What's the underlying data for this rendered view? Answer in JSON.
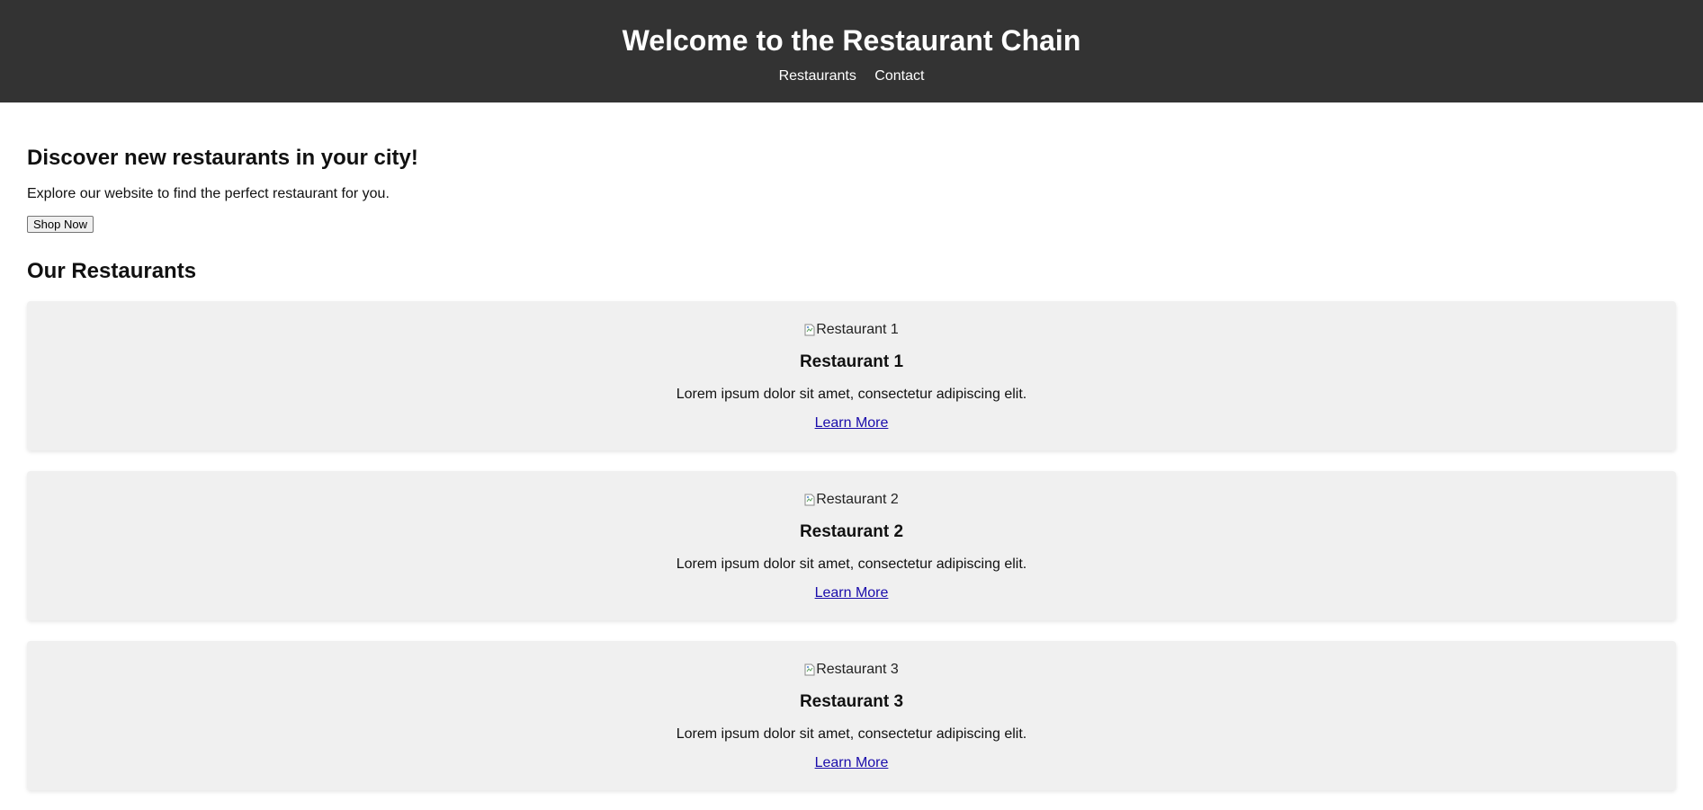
{
  "header": {
    "title": "Welcome to the Restaurant Chain",
    "nav": [
      {
        "label": "Restaurants"
      },
      {
        "label": "Contact"
      }
    ],
    "background_color": "#333333"
  },
  "hero": {
    "title": "Discover new restaurants in your city!",
    "text": "Explore our website to find the perfect restaurant for you.",
    "button_label": "Shop Now"
  },
  "restaurants_section": {
    "title": "Our Restaurants",
    "cards": [
      {
        "image_alt": "Restaurant 1",
        "name": "Restaurant 1",
        "description": "Lorem ipsum dolor sit amet, consectetur adipiscing elit.",
        "link_label": "Learn More"
      },
      {
        "image_alt": "Restaurant 2",
        "name": "Restaurant 2",
        "description": "Lorem ipsum dolor sit amet, consectetur adipiscing elit.",
        "link_label": "Learn More"
      },
      {
        "image_alt": "Restaurant 3",
        "name": "Restaurant 3",
        "description": "Lorem ipsum dolor sit amet, consectetur adipiscing elit.",
        "link_label": "Learn More"
      }
    ]
  },
  "colors": {
    "card_background": "#f0f0f0",
    "link": "#1a0dab"
  },
  "icons": {
    "broken_image": "broken-image-icon"
  }
}
